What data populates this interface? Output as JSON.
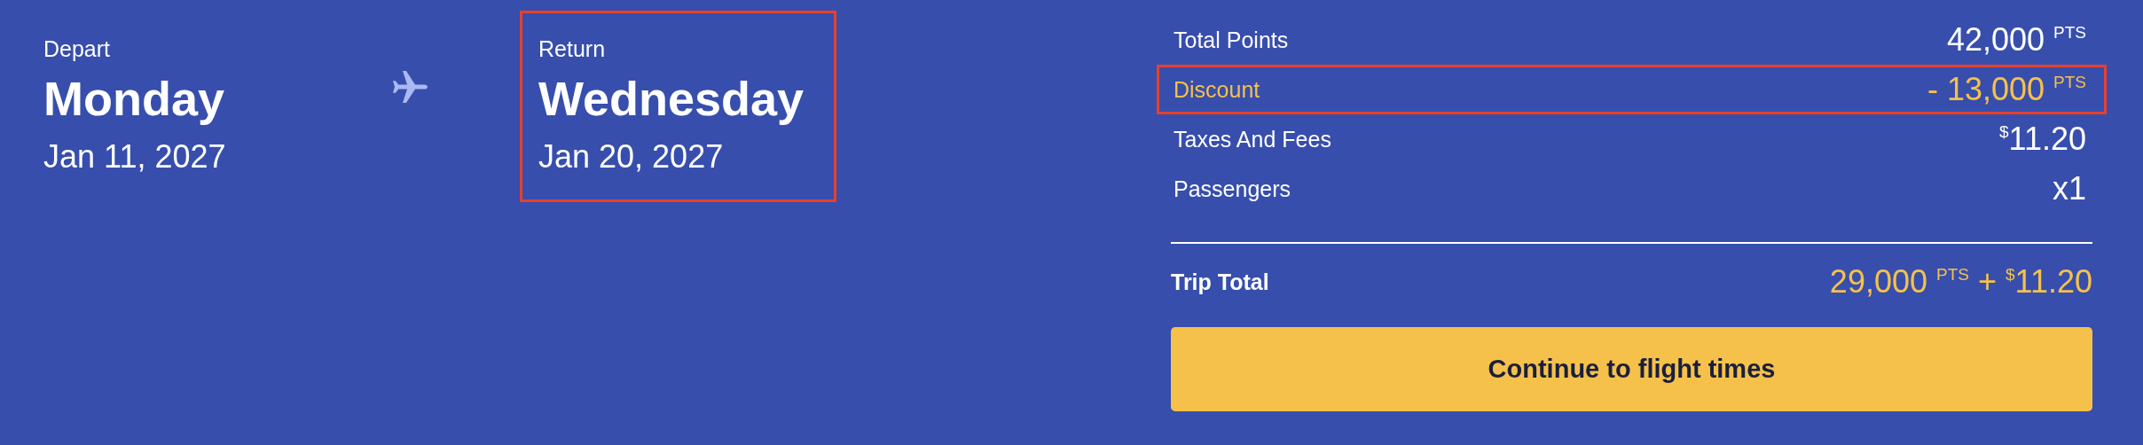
{
  "trip": {
    "depart": {
      "label": "Depart",
      "day": "Monday",
      "date": "Jan 11, 2027",
      "highlighted": false
    },
    "return": {
      "label": "Return",
      "day": "Wednesday",
      "date": "Jan 20, 2027",
      "highlighted": true
    }
  },
  "summary": {
    "rows": [
      {
        "label": "Total Points",
        "value": [
          {
            "text": "42,000",
            "raised": false
          },
          {
            "text": "PTS",
            "raised": true
          }
        ],
        "color": "#ffffff",
        "highlighted": false
      },
      {
        "label": "Discount",
        "value": [
          {
            "text": "- 13,000",
            "raised": false
          },
          {
            "text": "PTS",
            "raised": true
          }
        ],
        "color": "#f5c14b",
        "highlighted": true
      },
      {
        "label": "Taxes And Fees",
        "value": [
          {
            "text": "$",
            "raised": true
          },
          {
            "text": "11.20",
            "raised": false
          }
        ],
        "color": "#ffffff",
        "highlighted": false
      },
      {
        "label": "Passengers",
        "value": [
          {
            "text": "x1",
            "raised": false
          }
        ],
        "color": "#ffffff",
        "highlighted": false
      }
    ],
    "total": {
      "label": "Trip Total",
      "value": [
        {
          "text": "29,000",
          "raised": false
        },
        {
          "text": "PTS",
          "raised": true
        },
        {
          "text": "+",
          "raised": false
        },
        {
          "text": "$",
          "raised": true
        },
        {
          "text": "11.20",
          "raised": false
        }
      ]
    },
    "button": "Continue to flight times"
  }
}
